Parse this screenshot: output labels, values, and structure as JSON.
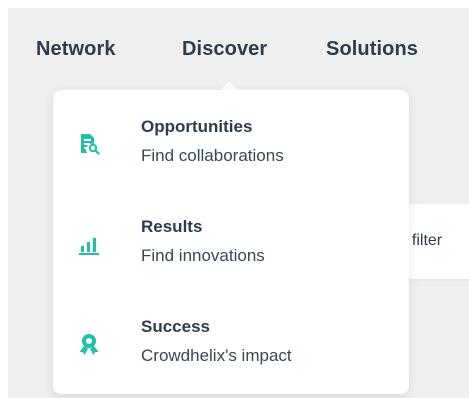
{
  "nav": {
    "items": [
      {
        "label": "Network"
      },
      {
        "label": "Discover"
      },
      {
        "label": "Solutions"
      }
    ]
  },
  "dropdown": {
    "items": [
      {
        "title": "Opportunities",
        "description": "Find collaborations",
        "icon": "document-search-icon"
      },
      {
        "title": "Results",
        "description": "Find innovations",
        "icon": "bar-chart-icon"
      },
      {
        "title": "Success",
        "description": "Crowdhelix's impact",
        "icon": "award-ribbon-icon"
      }
    ]
  },
  "filter": {
    "text": "t filter"
  },
  "colors": {
    "accent": "#1fbfa8",
    "text": "#2f3c4c",
    "background": "#efefef"
  }
}
